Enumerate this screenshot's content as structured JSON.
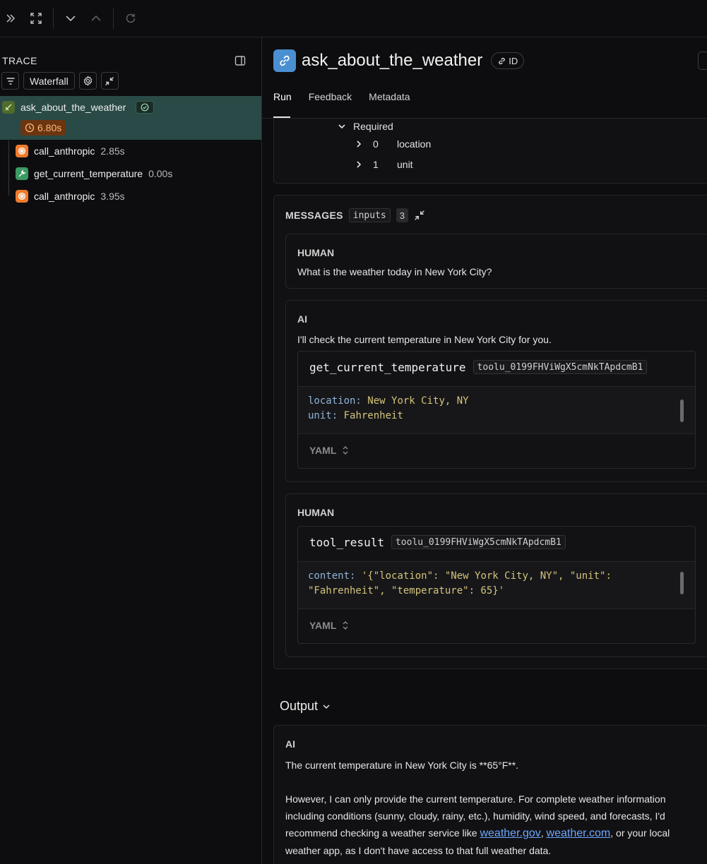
{
  "toolbar": {
    "icons": [
      "expand-right-icon",
      "fullscreen-icon",
      "chevron-down-icon",
      "chevron-up-icon",
      "refresh-icon"
    ]
  },
  "trace": {
    "title": "TRACE",
    "view_mode": "Waterfall",
    "root": {
      "name": "ask_about_the_weather",
      "duration": "6.80s",
      "status": "success"
    },
    "children": [
      {
        "name": "call_anthropic",
        "duration": "2.85s",
        "kind": "llm"
      },
      {
        "name": "get_current_temperature",
        "duration": "0.00s",
        "kind": "tool"
      },
      {
        "name": "call_anthropic",
        "duration": "3.95s",
        "kind": "llm"
      }
    ]
  },
  "run": {
    "title": "ask_about_the_weather",
    "id_label": "ID",
    "tabs": [
      "Run",
      "Feedback",
      "Metadata"
    ],
    "active_tab": "Run"
  },
  "schema": {
    "required_label": "Required",
    "items": [
      {
        "index": "0",
        "value": "location"
      },
      {
        "index": "1",
        "value": "unit"
      }
    ]
  },
  "messages": {
    "title": "MESSAGES",
    "chip": "inputs",
    "count": "3",
    "m1": {
      "role": "HUMAN",
      "text": "What is the weather today in New York City?"
    },
    "m2": {
      "role": "AI",
      "text": "I'll check the current temperature in New York City for you.",
      "tool_name": "get_current_temperature",
      "tool_id": "toolu_0199FHViWgX5cmNkTApdcmB1",
      "lines": [
        {
          "key": "location:",
          "value": "New York City, NY"
        },
        {
          "key": "unit:",
          "value": "Fahrenheit"
        }
      ],
      "format": "YAML"
    },
    "m3": {
      "role": "HUMAN",
      "tool_name": "tool_result",
      "tool_id": "toolu_0199FHViWgX5cmNkTApdcmB1",
      "key": "content:",
      "value_line1": "'{\"location\": \"New York City, NY\", \"unit\":",
      "value_line2": "\"Fahrenheit\", \"temperature\": 65}'",
      "format": "YAML"
    }
  },
  "output": {
    "title": "Output",
    "role": "AI",
    "para1": "The current temperature in New York City is **65°F**.",
    "para2_start": "However, I can only provide the current temperature. For complete weather information including conditions (sunny, cloudy, rainy, etc.), humidity, wind speed, and forecasts, I'd recommend checking a weather service like ",
    "link1": "weather.gov",
    "sep": ", ",
    "link2": "weather.com",
    "para2_end": ", or your local weather app, as I don't have access to that full weather data."
  },
  "colors": {
    "accent_blue": "#4a8fd1",
    "selected_row": "#294a46",
    "llm_icon": "#f07a2c",
    "tool_icon": "#3c9a63",
    "duration_badge": "#6b3510",
    "yaml_key": "#8fb4d9",
    "yaml_value": "#d4c47a",
    "link": "#6ea6ff"
  }
}
